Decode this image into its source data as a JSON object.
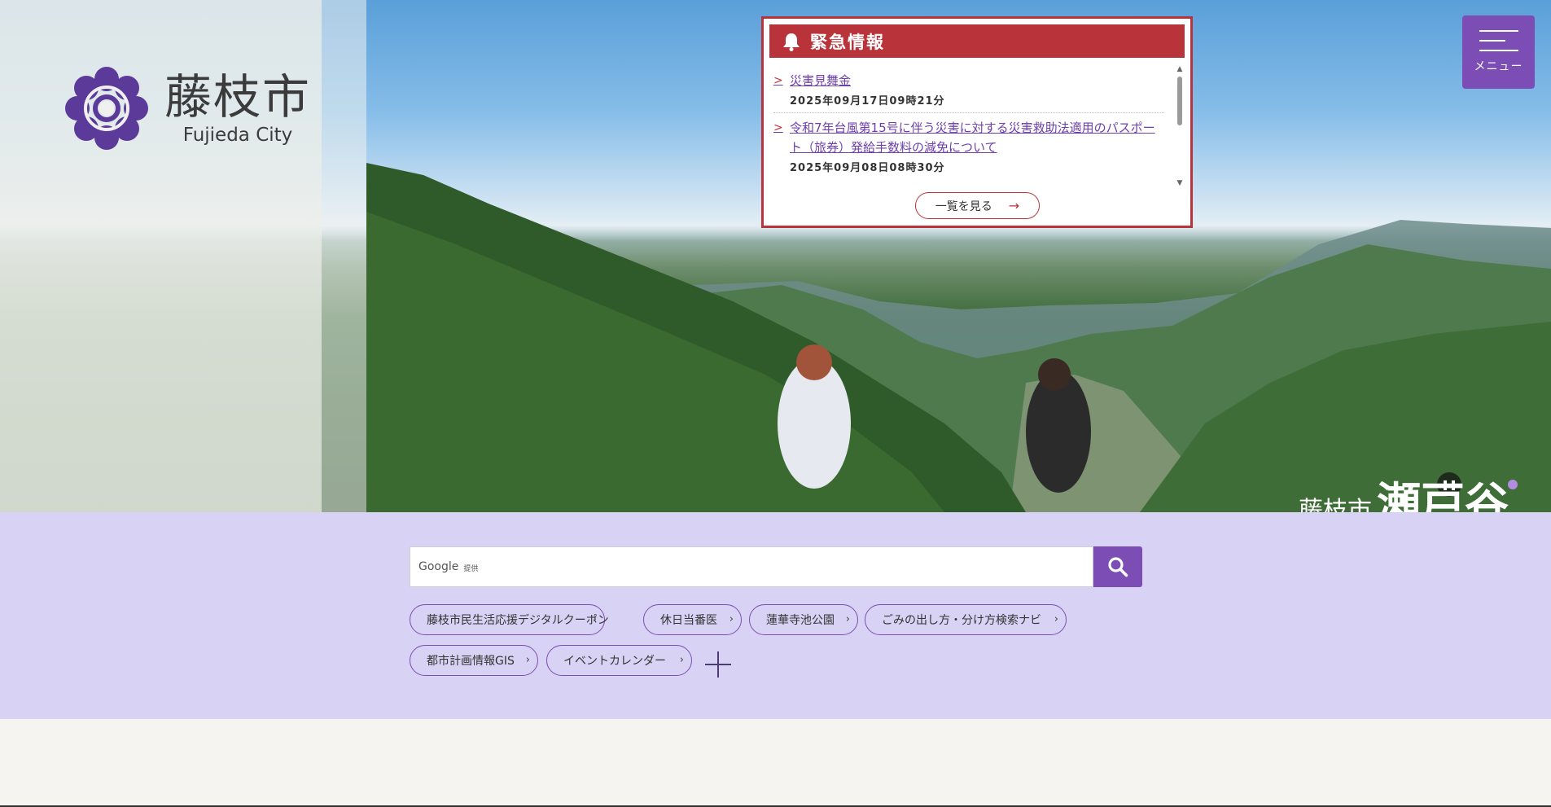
{
  "logo": {
    "name_ja": "藤枝市",
    "name_en": "Fujieda City"
  },
  "menu": {
    "label": "メニュー"
  },
  "emergency": {
    "title": "緊急情報",
    "items": [
      {
        "title": "災害見舞金",
        "date": "2025年09月17日09時21分"
      },
      {
        "title": "令和7年台風第15号に伴う災害に対する災害救助法適用のパスポート（旅券）発給手数料の減免について",
        "date": "2025年09月08日08時30分"
      }
    ],
    "more_label": "一覧を見る"
  },
  "slide": {
    "brand_small": "藤枝市",
    "brand_big": "瀬戸谷"
  },
  "search": {
    "brand": "Google",
    "brand_sub": "提供"
  },
  "quick_links": [
    "藤枝市民生活応援デジタルクーポン",
    "休日当番医",
    "蓮華寺池公園",
    "ごみの出し方・分け方検索ナビ",
    "都市計画情報GIS",
    "イベントカレンダー"
  ],
  "colors": {
    "brand_purple": "#7b4db5",
    "alert_red": "#b8343a",
    "band_lavender": "#d8d2f4"
  }
}
